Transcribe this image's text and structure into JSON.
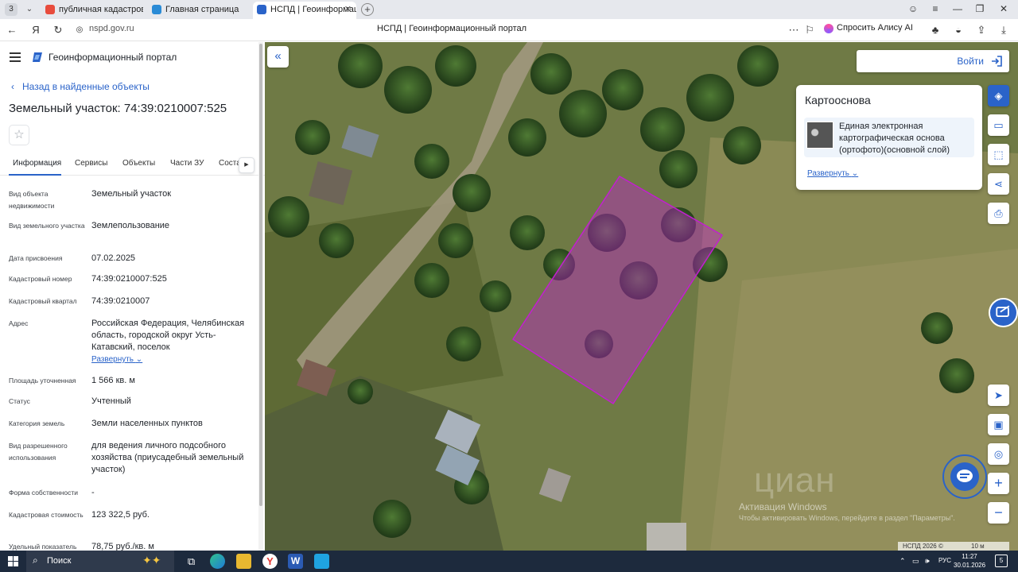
{
  "browser": {
    "tab_count": "3",
    "tabs": [
      {
        "label": "публичная кадастровая",
        "favicon_color": "#e84c3d"
      },
      {
        "label": "Главная страница",
        "favicon_color": "#2a8bd6"
      },
      {
        "label": "НСПД | Геоинформацио",
        "favicon_color": "#2a63c9"
      }
    ],
    "url": "nspd.gov.ru",
    "page_title": "НСПД | Геоинформационный портал",
    "alisa_label": "Спросить Алису AI"
  },
  "panel": {
    "app_title": "Геоинформационный портал",
    "back_label": "Назад в найденные объекты",
    "object_title": "Земельный участок: 74:39:0210007:525",
    "tabs": [
      "Информация",
      "Сервисы",
      "Объекты",
      "Части ЗУ",
      "Соста"
    ],
    "fields": [
      {
        "label": "Вид объекта недвижимости",
        "value": "Земельный участок"
      },
      {
        "label": "Вид земельного участка",
        "value": "Землепользование"
      },
      {
        "label": "Дата присвоения",
        "value": "07.02.2025"
      },
      {
        "label": "Кадастровый номер",
        "value": "74:39:0210007:525"
      },
      {
        "label": "Кадастровый квартал",
        "value": "74:39:0210007"
      },
      {
        "label": "Адрес",
        "value": "Российская Федерация, Челябинская область, городской округ Усть-Катавский, поселок",
        "expand": "Развернуть"
      },
      {
        "label": "Площадь уточненная",
        "value": "1 566 кв. м"
      },
      {
        "label": "Статус",
        "value": "Учтенный"
      },
      {
        "label": "Категория земель",
        "value": "Земли населенных пунктов"
      },
      {
        "label": "Вид разрешенного использования",
        "value": "для ведения личного подсобного хозяйства (приусадебный земельный участок)"
      },
      {
        "label": "Форма собственности",
        "value": "-"
      },
      {
        "label": "Кадастровая стоимость",
        "value": "123 322,5 руб."
      },
      {
        "label": "Удельный показатель",
        "value": "78,75 руб./кв. м"
      }
    ]
  },
  "map": {
    "login_label": "Войти",
    "basemap_title": "Картооснова",
    "basemap_layer": "Единая электронная картографическая основа (ортофото)(основной слой)",
    "basemap_expand": "Развернуть",
    "watermark_title": "Активация Windows",
    "watermark_sub": "Чтобы активировать Windows, перейдите в раздел \"Параметры\".",
    "cian_mark": "циан",
    "attribution": "НСПД 2026 ©",
    "scale_label": "10 м",
    "parcel_color": "#c21fd0"
  },
  "taskbar": {
    "search_label": "Поиск",
    "lang": "РУС",
    "time": "11:27",
    "date": "30.01.2026",
    "notifications": "5"
  }
}
